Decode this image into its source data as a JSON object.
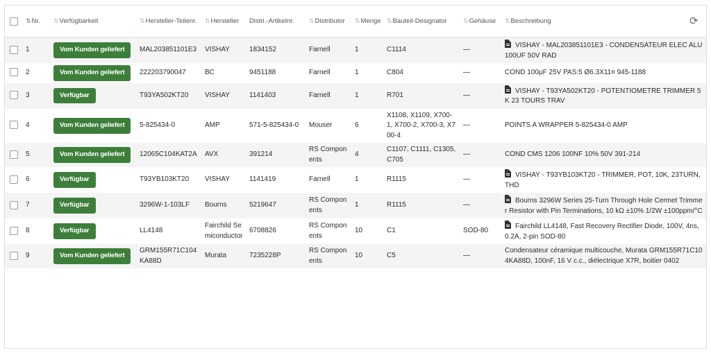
{
  "columns": {
    "nr": "Nr.",
    "availability": "Verfügbarkeit",
    "mfr_part": "Hersteller-Teilenr.",
    "manufacturer": "Hersteller",
    "distri_part": "Distri.-Artikelnr.",
    "distributor": "Distributor",
    "qty": "Menge",
    "designator": "Bauteil-Designator",
    "package": "Gehäuse",
    "description": "Beschreibung"
  },
  "icons": {
    "sort": "sort-arrows-icon",
    "refresh": "refresh-icon",
    "datasheet": "document-icon"
  },
  "colors": {
    "badge_green": "#3d7f3a",
    "row_stripe": "#f4f4f4"
  },
  "rows": [
    {
      "nr": "1",
      "availability": "Vom Kunden geliefert",
      "mfr_part": "MAL203851101E3",
      "manufacturer": "VISHAY",
      "distri_part": "1834152",
      "distributor": "Farnell",
      "qty": "1",
      "designator": "C1114",
      "package": "—",
      "has_doc": true,
      "description": "VISHAY - MAL203851101E3 - CONDENSATEUR ELEC ALU 100UF 50V RAD"
    },
    {
      "nr": "2",
      "availability": "Vom Kunden geliefert",
      "mfr_part": "222203790047",
      "manufacturer": "BC",
      "distri_part": "9451188",
      "distributor": "Farnell",
      "qty": "1",
      "designator": "C804",
      "package": "—",
      "has_doc": false,
      "description": "COND 100µF 25V PAS:5 Ø6.3X11¤ 945-1188"
    },
    {
      "nr": "3",
      "availability": "Verfügbar",
      "mfr_part": "T93YA502KT20",
      "manufacturer": "VISHAY",
      "distri_part": "1141403",
      "distributor": "Farnell",
      "qty": "1",
      "designator": "R701",
      "package": "—",
      "has_doc": true,
      "description": "VISHAY - T93YA502KT20 - POTENTIOMETRE TRIMMER 5K 23 TOURS TRAV"
    },
    {
      "nr": "4",
      "availability": "Vom Kunden geliefert",
      "mfr_part": "5-825434-0",
      "manufacturer": "AMP",
      "distri_part": "571-5-825434-0",
      "distributor": "Mouser",
      "qty": "6",
      "designator": "X1108, X1109, X700-1, X700-2, X700-3, X700-4",
      "package": "—",
      "has_doc": false,
      "description": "POINTS A WRAPPER 5-825434-0 AMP"
    },
    {
      "nr": "5",
      "availability": "Vom Kunden geliefert",
      "mfr_part": "12065C104KAT2A",
      "manufacturer": "AVX",
      "distri_part": "391214",
      "distributor": "RS Components",
      "qty": "4",
      "designator": "C1107, C1111, C1305, C705",
      "package": "—",
      "has_doc": false,
      "description": "COND CMS 1206 100NF 10% 50V 391-214"
    },
    {
      "nr": "6",
      "availability": "Verfügbar",
      "mfr_part": "T93YB103KT20",
      "manufacturer": "VISHAY",
      "distri_part": "1141419",
      "distributor": "Farnell",
      "qty": "1",
      "designator": "R1115",
      "package": "—",
      "has_doc": true,
      "description": "VISHAY - T93YB103KT20 - TRIMMER, POT, 10K, 23TURN, THD"
    },
    {
      "nr": "7",
      "availability": "Verfügbar",
      "mfr_part": "3296W-1-103LF",
      "manufacturer": "Bourns",
      "distri_part": "5219647",
      "distributor": "RS Components",
      "qty": "1",
      "designator": "R1115",
      "package": "—",
      "has_doc": true,
      "description": "Bourns 3296W Series 25-Turn Through Hole Cermet Trimmer Resistor with Pin Terminations, 10 kΩ ±10% 1/2W ±100ppm/°C"
    },
    {
      "nr": "8",
      "availability": "Verfügbar",
      "mfr_part": "LL4148",
      "manufacturer": "Fairchild Semiconductor",
      "distri_part": "6708826",
      "distributor": "RS Components",
      "qty": "10",
      "designator": "C1",
      "package": "SOD-80",
      "has_doc": true,
      "description": "Fairchild LL4148, Fast Recovery Rectifier Diode, 100V, 4ns, 0.2A, 2-pin SOD-80"
    },
    {
      "nr": "9",
      "availability": "Vom Kunden geliefert",
      "mfr_part": "GRM155R71C104KA88D",
      "manufacturer": "Murata",
      "distri_part": "7235228P",
      "distributor": "RS Components",
      "qty": "10",
      "designator": "C5",
      "package": "—",
      "has_doc": false,
      "description": "Condensateur céramique multicouche, Murata GRM155R71C104KA88D, 100nF, 16 V c.c., diélectrique X7R, boitier 0402"
    }
  ]
}
